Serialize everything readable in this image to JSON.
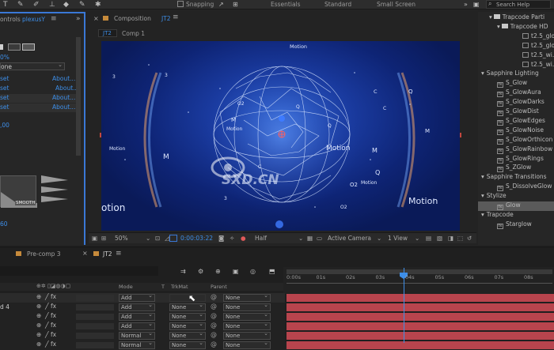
{
  "toolbar": {
    "snapping_label": "Snapping",
    "workspaces": [
      "Essentials",
      "Standard",
      "Small Screen"
    ],
    "search_help": "Search Help"
  },
  "left_panel": {
    "tab_prefix": "ontrols",
    "tab_layer": "plexusY",
    "percent_value": "0%",
    "dropdown_value": "one",
    "rows": [
      {
        "reset": "set",
        "about": "About..."
      },
      {
        "reset": "set",
        "about": "About..."
      },
      {
        "reset": "set",
        "about": "About..."
      },
      {
        "reset": "set",
        "about": "About..."
      }
    ],
    "value_00": ",00",
    "smooth_label": "SMOOTH",
    "value_60": "60"
  },
  "comp_panel": {
    "tab_prefix": "Composition",
    "tab_name": "JT2",
    "breadcrumb_current": "JT2",
    "breadcrumb_parent": "Comp 1",
    "viewer_texts": {
      "motion_top": "Motion",
      "motion_mid": "Motion",
      "motion_center": "Motion",
      "motion_right_small": "Motion",
      "motion_left_small": "Motion",
      "motion_left_big": "otion",
      "motion_right_big": "Motion",
      "m1": "M",
      "m2": "M",
      "m3": "M",
      "m4": "M",
      "q1": "Q",
      "q2": "Q",
      "q3": "Q",
      "q4": "Q",
      "c1": "C",
      "c2": "C",
      "c3": "C",
      "o2a": "O2",
      "o2b": "O2",
      "o2c": "O2",
      "n3a": "3",
      "n3b": "3",
      "n3c": "3",
      "watermark": "SXD.CN"
    },
    "viewer_bar": {
      "zoom": "50%",
      "timecode": "0:00:03:22",
      "resolution": "Half",
      "camera": "Active Camera",
      "view": "1 View"
    }
  },
  "right_panel": {
    "items": [
      {
        "type": "folder",
        "label": "Trapcode Parti"
      },
      {
        "type": "folder",
        "label": "Trapcode HD"
      },
      {
        "type": "file",
        "label": "t2.5_glow"
      },
      {
        "type": "file",
        "label": "t2.5_glow"
      },
      {
        "type": "file",
        "label": "t2.5_wi..."
      },
      {
        "type": "file",
        "label": "t2.5_wi..."
      },
      {
        "type": "group",
        "label": "Sapphire Lighting"
      },
      {
        "type": "fx",
        "label": "S_Glow"
      },
      {
        "type": "fx",
        "label": "S_GlowAura"
      },
      {
        "type": "fx",
        "label": "S_GlowDarks"
      },
      {
        "type": "fx",
        "label": "S_GlowDist"
      },
      {
        "type": "fx",
        "label": "S_GlowEdges"
      },
      {
        "type": "fx",
        "label": "S_GlowNoise"
      },
      {
        "type": "fx",
        "label": "S_GlowOrthicon"
      },
      {
        "type": "fx",
        "label": "S_GlowRainbow"
      },
      {
        "type": "fx",
        "label": "S_GlowRings"
      },
      {
        "type": "fx",
        "label": "S_ZGlow"
      },
      {
        "type": "group",
        "label": "Sapphire Transitions"
      },
      {
        "type": "fx",
        "label": "S_DissolveGlow"
      },
      {
        "type": "group",
        "label": "Stylize"
      },
      {
        "type": "fx",
        "label": "Glow",
        "selected": true
      },
      {
        "type": "group",
        "label": "Trapcode"
      },
      {
        "type": "fx",
        "label": "Starglow"
      }
    ]
  },
  "timeline": {
    "tabs": [
      "Pre-comp 3",
      "JT2"
    ],
    "columns": {
      "mode": "Mode",
      "t": "T",
      "trkmat": "TrkMat",
      "parent": "Parent"
    },
    "ruler": [
      "0:00s",
      "01s",
      "02s",
      "03s",
      "04s",
      "05s",
      "06s",
      "07s",
      "08s"
    ],
    "layers": [
      {
        "name": "",
        "mode": "Add",
        "trkmat": "",
        "parent": "None"
      },
      {
        "name": "d 4",
        "mode": "Add",
        "trkmat": "None",
        "parent": "None"
      },
      {
        "name": "",
        "mode": "Add",
        "trkmat": "None",
        "parent": "None"
      },
      {
        "name": "",
        "mode": "Add",
        "trkmat": "None",
        "parent": "None"
      },
      {
        "name": "",
        "mode": "Normal",
        "trkmat": "None",
        "parent": "None"
      },
      {
        "name": "",
        "mode": "Normal",
        "trkmat": "None",
        "parent": "None"
      }
    ]
  },
  "colors": {
    "accent": "#3a78d6",
    "bar": "#b8444d",
    "panel": "#262626"
  }
}
